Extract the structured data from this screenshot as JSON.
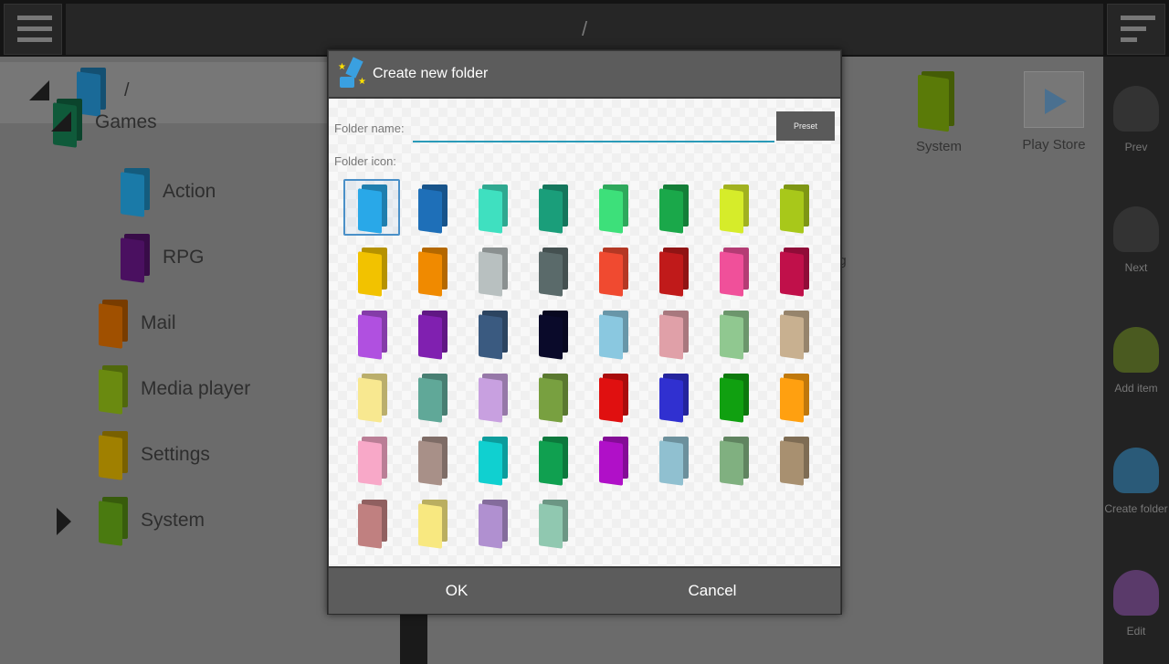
{
  "topbar": {
    "path": "/",
    "menu_icon": "hamburger-icon",
    "sort_icon": "sort-icon"
  },
  "tree": {
    "root": "/",
    "items": [
      {
        "label": "Games",
        "color": "#0f5a3a"
      },
      {
        "label": "Action",
        "color": "#1a7aa8"
      },
      {
        "label": "RPG",
        "color": "#4a1060"
      },
      {
        "label": "Mail",
        "color": "#a05000"
      },
      {
        "label": "Media player",
        "color": "#6a8a10"
      },
      {
        "label": "Settings",
        "color": "#a08000"
      },
      {
        "label": "System",
        "color": "#4a7a10"
      }
    ]
  },
  "background_grid": {
    "items": [
      {
        "label": "System"
      },
      {
        "label": "Play Store"
      }
    ],
    "partial_a": "s",
    "partial_b": "ng"
  },
  "sidebar": {
    "items": [
      {
        "label": "Prev"
      },
      {
        "label": "Next"
      },
      {
        "label": "Add item"
      },
      {
        "label": "Create folder"
      },
      {
        "label": "Edit"
      }
    ]
  },
  "dialog": {
    "title": "Create new folder",
    "folder_name_label": "Folder name:",
    "folder_name_value": "",
    "preset_label": "Preset",
    "folder_icon_label": "Folder icon:",
    "selected_index": 0,
    "folder_colors": [
      "#29a8e8",
      "#1e6fb8",
      "#3fe0c0",
      "#1a9e7a",
      "#3de07a",
      "#1aa84a",
      "#d6ec2a",
      "#a8c81a",
      "#f2c200",
      "#f08a00",
      "#b8c0c0",
      "#5a6a6a",
      "#f04a30",
      "#c01a1a",
      "#f0509a",
      "#c0104a",
      "#b050e0",
      "#8020b0",
      "#3a5a80",
      "#0a0a2a",
      "#8ac8e0",
      "#e0a0a8",
      "#90c890",
      "#c8b090",
      "#f8e890",
      "#60a898",
      "#c8a0e0",
      "#78a040",
      "#e01010",
      "#3030d0",
      "#10a010",
      "#ffa010",
      "#f8a8c8",
      "#a89088",
      "#10d0d0",
      "#10a050",
      "#b010c8",
      "#90c0d0",
      "#80b080",
      "#a89070",
      "#c08080",
      "#f8e880",
      "#b090d0",
      "#90c8b0"
    ],
    "ok_label": "OK",
    "cancel_label": "Cancel"
  }
}
